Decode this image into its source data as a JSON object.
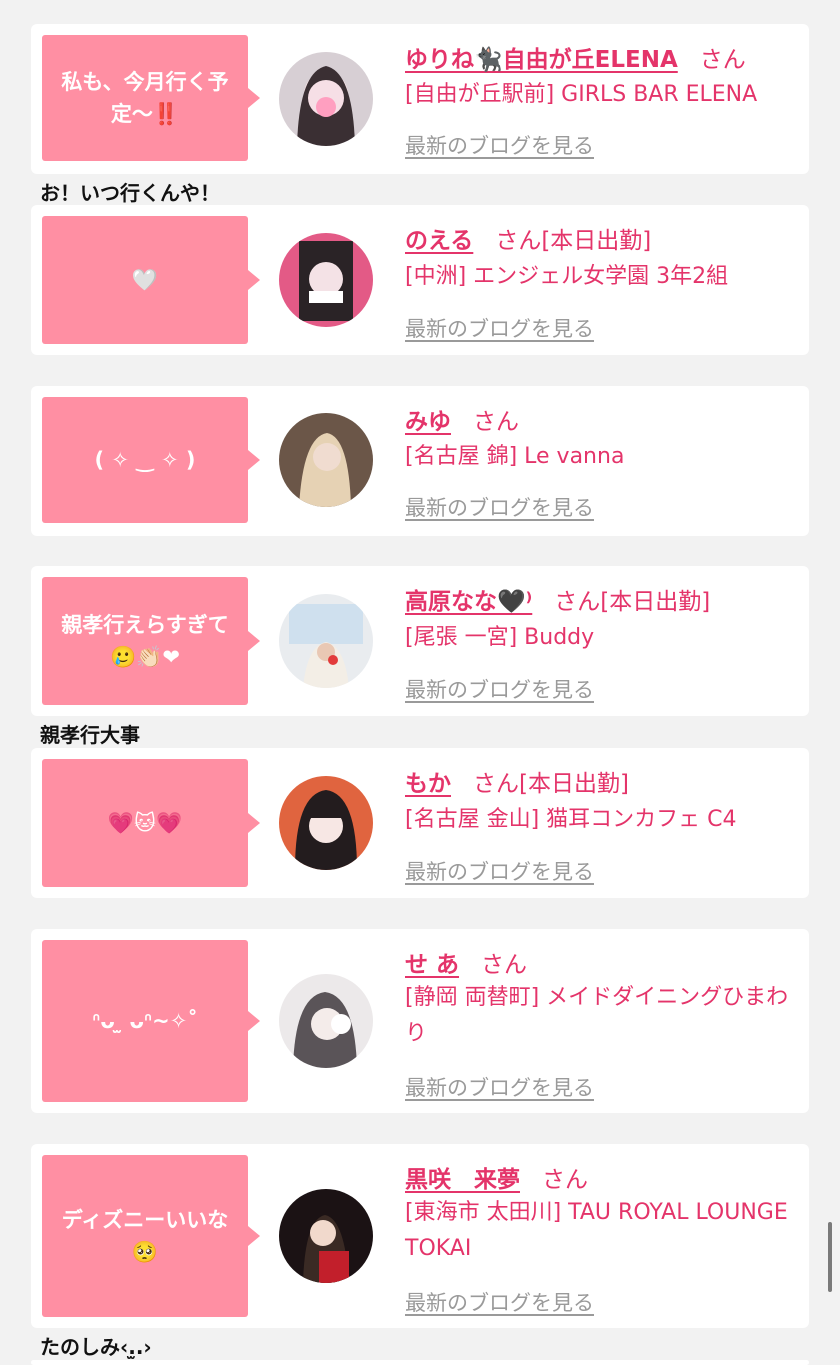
{
  "blog_link_label": "最新のブログを見る",
  "honorific": "さん",
  "cards": [
    {
      "bubble": "私も、今月行く予定〜‼️",
      "name": "ゆりね🐈‍⬛自由が丘ELENA",
      "status": "",
      "shop": "[自由が丘駅前] GIRLS BAR ELENA"
    },
    {
      "bubble": "🤍",
      "name": "のえる",
      "status": "[本日出勤]",
      "shop": "[中洲] エンジェル女学園 3年2組"
    },
    {
      "bubble": "( ✧ ‿ ✧ )",
      "name": "みゆ",
      "status": "",
      "shop": "[名古屋 錦] Le vanna"
    },
    {
      "bubble": "親孝行えらすぎて🥲👏🏻❤",
      "name": "高原なな🖤⁾",
      "status": "[本日出勤]",
      "shop": "[尾張 一宮] Buddy"
    },
    {
      "bubble": "💗🐱💗",
      "name": "もか",
      "status": "[本日出勤]",
      "shop": "[名古屋 金山] 猫耳コンカフェ C4"
    },
    {
      "bubble": "ᐢᴗ ̫ ᴗᐢ~✧˚",
      "name": "せ あ",
      "status": "",
      "shop": "[静岡 両替町] メイドダイニングひまわり"
    },
    {
      "bubble": "ディズニーいいな🥺",
      "name": "黒咲　来夢",
      "status": "",
      "shop": "[東海市 太田川] TAU ROYAL LOUNGE TOKAI"
    }
  ],
  "comments": {
    "c1": "お！いつ行くんや！",
    "c4": "親孝行大事",
    "c7": "たのしみ‹.̫.›"
  },
  "colors": {
    "bubble": "#ff8fa3",
    "name": "#e4346a",
    "link": "#9a9a9a"
  }
}
